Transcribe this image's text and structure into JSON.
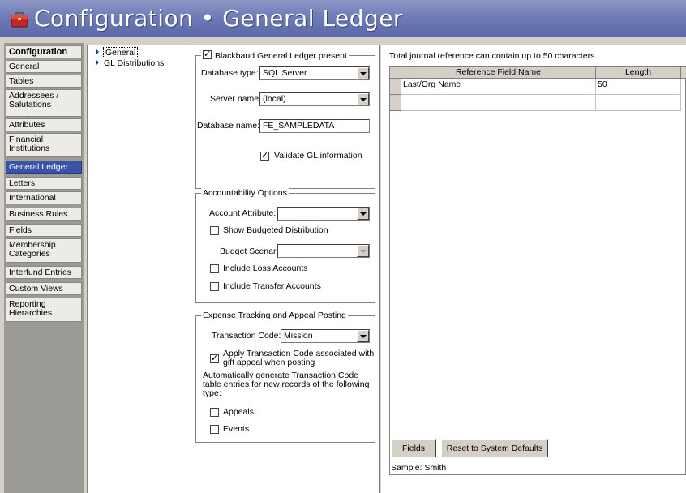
{
  "window": {
    "title": "Configuration • General Ledger"
  },
  "nav": {
    "items": [
      {
        "label": "Configuration"
      },
      {
        "label": "General"
      },
      {
        "label": "Tables"
      },
      {
        "label": "Addressees / Salutations"
      },
      {
        "label": "Attributes"
      },
      {
        "label": "Financial Institutions"
      },
      {
        "label": "General Ledger"
      },
      {
        "label": "Letters"
      },
      {
        "label": "International"
      },
      {
        "label": "Business Rules"
      },
      {
        "label": "Fields"
      },
      {
        "label": "Membership Categories"
      },
      {
        "label": "Interfund Entries"
      },
      {
        "label": "Custom Views"
      },
      {
        "label": "Reporting Hierarchies"
      }
    ],
    "active": "General Ledger"
  },
  "tree": {
    "items": [
      {
        "label": "General"
      },
      {
        "label": "GL Distributions"
      }
    ]
  },
  "gl_group": {
    "checkbox_label": "Blackbaud General Ledger present",
    "checked": true,
    "database_type_label": "Database type:",
    "database_type_value": "SQL Server",
    "server_name_label": "Server name:",
    "server_name_value": "(local)",
    "database_name_label": "Database name:",
    "database_name_value": "FE_SAMPLEDATA",
    "validate_label": "Validate GL information",
    "validate_checked": true
  },
  "accountability": {
    "legend": "Accountability Options",
    "account_attribute_label": "Account Attribute:",
    "account_attribute_value": "",
    "show_budgeted_label": "Show Budgeted Distribution",
    "budget_scenario_label": "Budget Scenario:",
    "budget_scenario_value": "",
    "include_loss_label": "Include Loss Accounts",
    "include_transfer_label": "Include Transfer Accounts"
  },
  "expense": {
    "legend": "Expense Tracking and Appeal Posting",
    "transaction_code_label": "Transaction Code:",
    "transaction_code_value": "Mission",
    "apply_label_1": "Apply Transaction Code associated with",
    "apply_label_2": "gift appeal when posting",
    "apply_checked": true,
    "auto_gen_text_1": "Automatically generate Transaction Code",
    "auto_gen_text_2": "table entries for new records of the following",
    "auto_gen_text_3": "type:",
    "appeals_label": "Appeals",
    "events_label": "Events"
  },
  "reference": {
    "note": "Total journal reference can contain up to 50 characters.",
    "columns": [
      "Reference Field Name",
      "Length"
    ],
    "rows": [
      {
        "name": "Last/Org Name",
        "length": "50"
      }
    ],
    "fields_button": "Fields",
    "reset_button": "Reset to System Defaults",
    "sample": "Sample: Smith"
  },
  "colors": {
    "title_bar": "#6f7cb6",
    "nav_active": "#3a52a8"
  }
}
